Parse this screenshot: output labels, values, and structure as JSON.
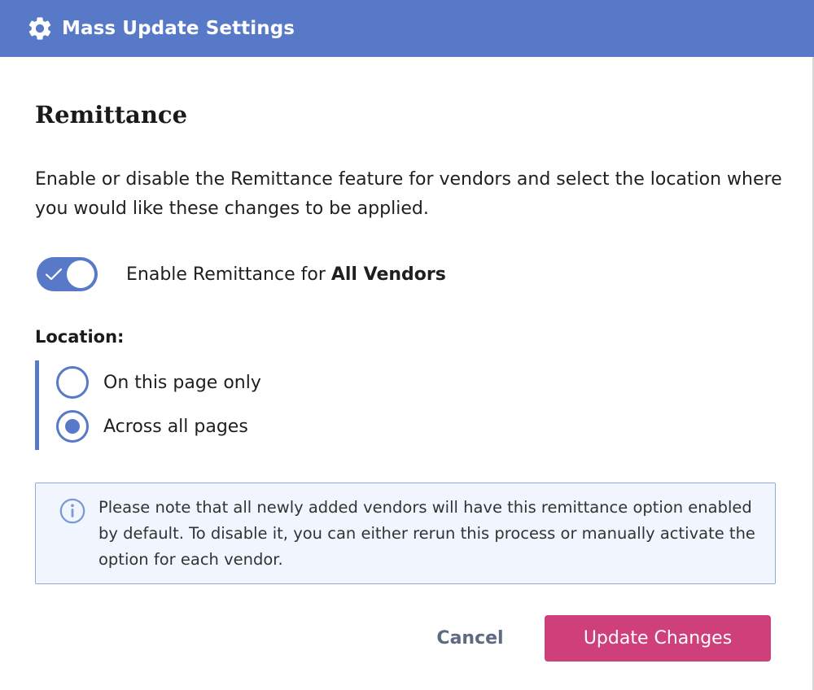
{
  "header": {
    "title": "Mass Update Settings",
    "icon": "gear-icon"
  },
  "section": {
    "title": "Remittance",
    "description": "Enable or disable the Remittance feature for vendors and select the location where you would like these changes to be applied."
  },
  "toggle": {
    "enabled": true,
    "label_prefix": "Enable Remittance for ",
    "label_bold": "All Vendors"
  },
  "location": {
    "label": "Location:",
    "options": [
      {
        "label": "On this page only",
        "selected": false
      },
      {
        "label": "Across all pages",
        "selected": true
      }
    ]
  },
  "note": {
    "icon": "info-icon",
    "text": "Please note that all newly added vendors will have this remittance option enabled by default. To disable it, you can either rerun this process or manually activate the option for each vendor."
  },
  "actions": {
    "cancel_label": "Cancel",
    "update_label": "Update Changes"
  },
  "colors": {
    "accent": "#5779c8",
    "primary_button": "#cf3f7a",
    "note_background": "#f1f5fd"
  }
}
